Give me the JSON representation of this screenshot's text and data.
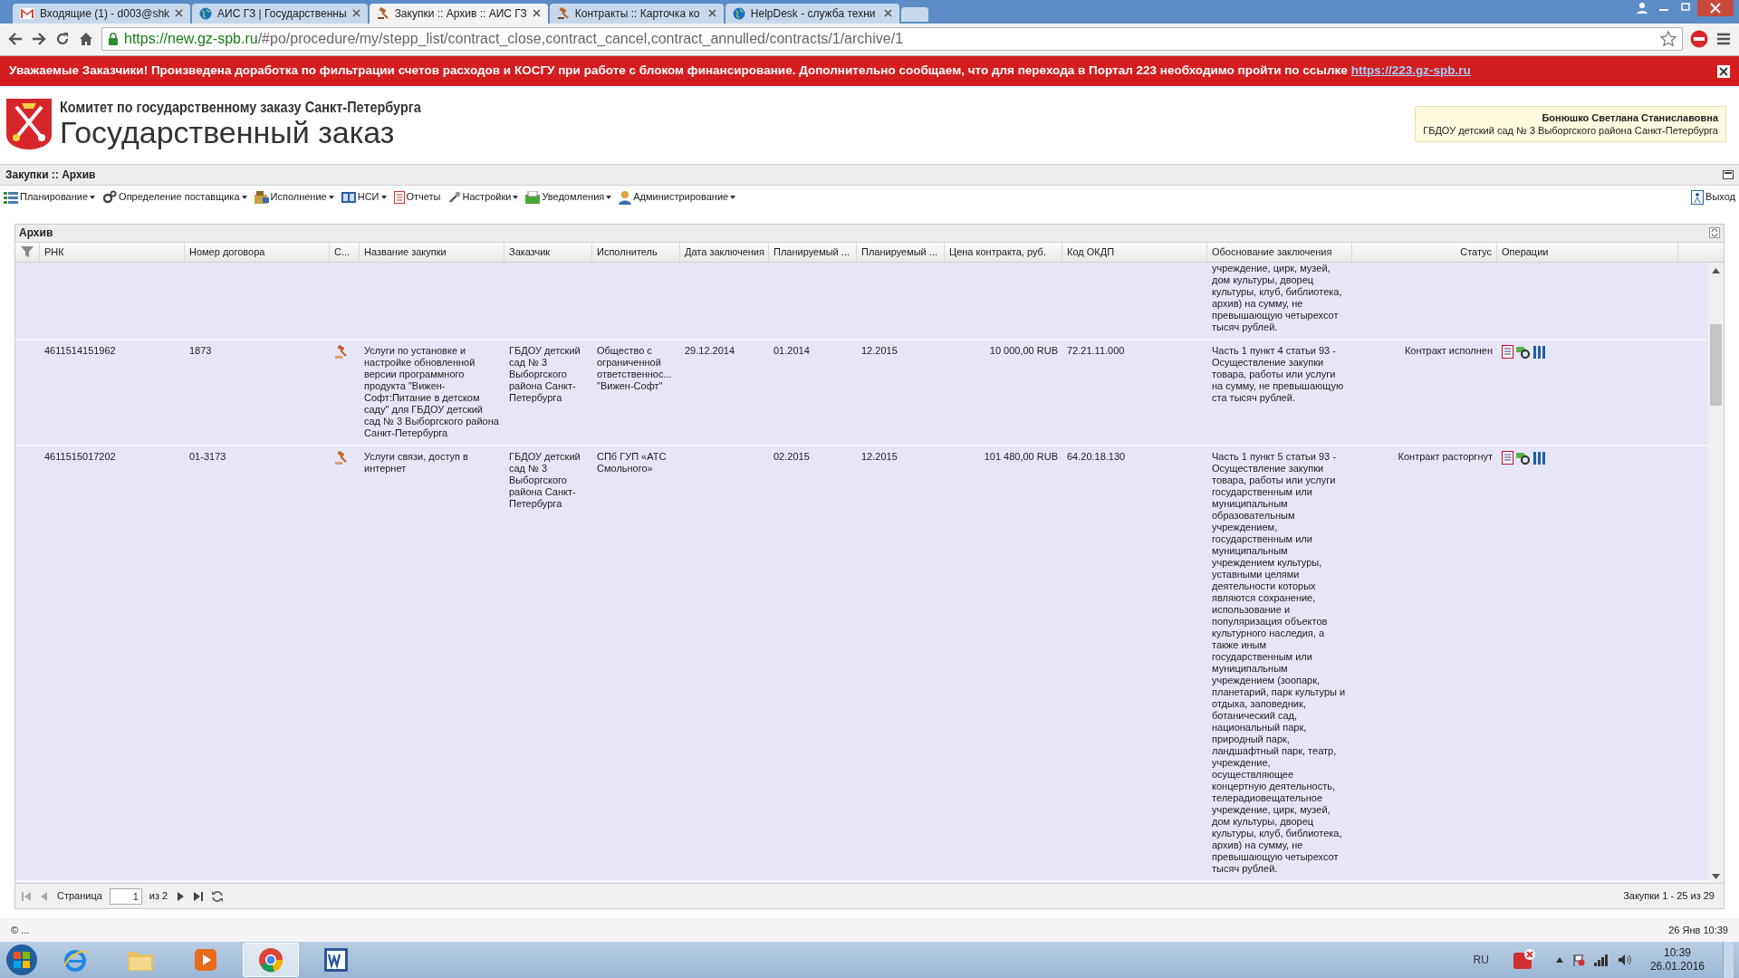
{
  "browser": {
    "tabs": [
      {
        "title": "Входящие (1) - d003@shk",
        "selected": false
      },
      {
        "title": "АИС ГЗ | Государственны",
        "selected": false
      },
      {
        "title": "Закупки :: Архив :: АИС ГЗ",
        "selected": true
      },
      {
        "title": "Контракты :: Карточка ко",
        "selected": false
      },
      {
        "title": "HelpDesk - служба техни",
        "selected": false
      }
    ],
    "url": "https://new.gz-spb.ru/#po/procedure/my/stepp_list/contract_close,contract_cancel,contract_annulled/contracts/1/archive/1"
  },
  "banner": {
    "text": "Уважаемые Заказчики! Произведена доработка по фильтрации счетов расходов и КОСГУ при работе с блоком финансирование. Дополнительно сообщаем, что для перехода в Портал 223 необходимо пройти по ссылке",
    "link": "https://223.gz-spb.ru"
  },
  "header": {
    "org": "Комитет по государственному заказу Санкт-Петербурга",
    "title": "Государственный заказ",
    "user_name": "Бонюшко Светлана Станиславовна",
    "user_org": "ГБДОУ детский сад № 3 Выборгского района Санкт-Петербурга"
  },
  "page_title": "Закупки :: Архив",
  "menu": [
    {
      "label": "Планирование",
      "has_menu": true
    },
    {
      "label": "Определение поставщика",
      "has_menu": true
    },
    {
      "label": "Исполнение",
      "has_menu": true
    },
    {
      "label": "НСИ",
      "has_menu": true
    },
    {
      "label": "Отчеты",
      "has_menu": false
    },
    {
      "label": "Настройки",
      "has_menu": true
    },
    {
      "label": "Уведомления",
      "has_menu": true
    },
    {
      "label": "Администрирование",
      "has_menu": true
    }
  ],
  "logout": "Выход",
  "panel": {
    "title": "Архив",
    "columns": [
      "РНК",
      "Номер договора",
      "С...",
      "Название закупки",
      "Заказчик",
      "Исполнитель",
      "Дата заключения",
      "Планируемый ...",
      "Планируемый ...",
      "Цена контракта, руб.",
      "Код ОКДП",
      "Обоснование заключения",
      "Статус",
      "Операции"
    ],
    "rows": [
      {
        "reason": "учреждение, цирк, музей, дом культуры, дворец культуры, клуб, библиотека, архив) на сумму, не превышающую четырехсот тысяч рублей.",
        "has_type_icon": false,
        "has_operations": false
      },
      {
        "rnk": "4611514151962",
        "number": "1873",
        "has_type_icon": true,
        "name": "Услуги по установке и настройке обновленной версии программного продукта \"Вижен-Софт:Питание в детском саду\" для ГБДОУ детский сад № 3 Выборгского района Санкт-Петербурга",
        "customer": "ГБДОУ детский сад № 3 Выборгского района Санкт-Петербурга",
        "supplier": "Общество с ограниченной ответственнос... \"Вижен-Софт\"",
        "date": "29.12.2014",
        "plan_start": "01.2014",
        "plan_end": "12.2015",
        "price": "10 000,00 RUB",
        "okdp": "72.21.11.000",
        "reason": "Часть 1 пункт 4 статьи 93 - Осуществление закупки товара, работы или услуги на сумму, не превышающую ста тысяч рублей.",
        "status": "Контракт исполнен",
        "has_operations": true
      },
      {
        "rnk": "4611515017202",
        "number": "01-3173",
        "has_type_icon": true,
        "name": "Услуги связи, доступ в интернет",
        "customer": "ГБДОУ детский сад № 3 Выборгского района Санкт-Петербурга",
        "supplier": "СПб ГУП «АТС Смольного»",
        "plan_start": "02.2015",
        "plan_end": "12.2015",
        "price": "101 480,00 RUB",
        "okdp": "64.20.18.130",
        "reason": "Часть 1 пункт 5 статьи 93 - Осуществление закупки товара, работы или услуги государственным или муниципальным образовательным учреждением, государственным или муниципальным учреждением культуры, уставными целями деятельности которых являются сохранение, использование и популяризация объектов культурного наследия, а также иным государственным или муниципальным учреждением (зоопарк, планетарий, парк культуры и отдыха, заповедник, ботанический сад, национальный парк, природный парк, ландшафтный парк, театр, учреждение, осуществляющее концертную деятельность, телерадиовещательное учреждение, цирк, музей, дом культуры, дворец культуры, клуб, библиотека, архив) на сумму, не превышающую четырехсот тысяч рублей.",
        "status": "Контракт расторгнут",
        "has_operations": true
      }
    ]
  },
  "pager": {
    "page_label": "Страница",
    "page": "1",
    "of": "из 2",
    "summary": "Закупки 1 - 25 из 29"
  },
  "status": {
    "left": "© ...",
    "right": "26 Янв 10:39"
  },
  "taskbar": {
    "apps": [
      {
        "kind": "ie",
        "selected": false
      },
      {
        "kind": "folder",
        "selected": false
      },
      {
        "kind": "player",
        "selected": false
      },
      {
        "kind": "chrome",
        "selected": true
      },
      {
        "kind": "word",
        "selected": false
      }
    ],
    "lang": "RU",
    "time": "10:39",
    "date": "26.01.2016"
  }
}
